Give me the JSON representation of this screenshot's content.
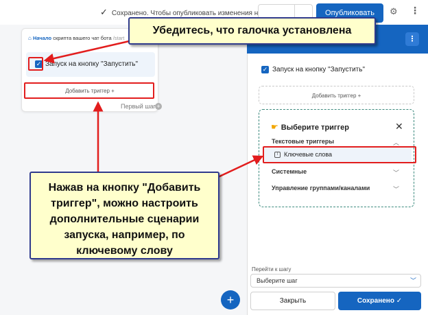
{
  "topbar": {
    "save_status": "Сохранено. Чтобы опубликовать изменения нажмите",
    "publish_label": "Опубликовать"
  },
  "node": {
    "head_prefix": "Начало",
    "head_text": " скрипта вашего чат бота ",
    "command": "/start",
    "trigger_label": "Запуск на кнопку \"Запустить\"",
    "add_trigger": "Добавить триггер  +",
    "first_step": "Первый шаг"
  },
  "panel": {
    "trigger_label": "Запуск на кнопку \"Запустить\"",
    "add_trigger": "Добавить триггер  +",
    "popup": {
      "title": "Выберите триггер",
      "groups": [
        {
          "label": "Текстовые триггеры",
          "expanded": true
        },
        {
          "label": "Системные",
          "expanded": false
        },
        {
          "label": "Управление группами/каналами",
          "expanded": false
        }
      ],
      "option": "Ключевые слова"
    },
    "goto_label": "Перейти к шагу",
    "goto_placeholder": "Выберите шаг",
    "close_label": "Закрыть",
    "saved_label": "Сохранено"
  },
  "annotations": {
    "top": "Убедитесь, что галочка установлена",
    "main_lines": [
      "Нажав на кнопку \"Добавить",
      "триггер\", можно настроить",
      "дополнительные сценарии",
      "запуска, например, по",
      "ключевому слову"
    ]
  },
  "colors": {
    "brand": "#1565c0",
    "callout_fill": "#ffffcc",
    "callout_border": "#2f3a8c",
    "highlight": "#e21d1d",
    "popup_border": "#3c8a7e"
  }
}
